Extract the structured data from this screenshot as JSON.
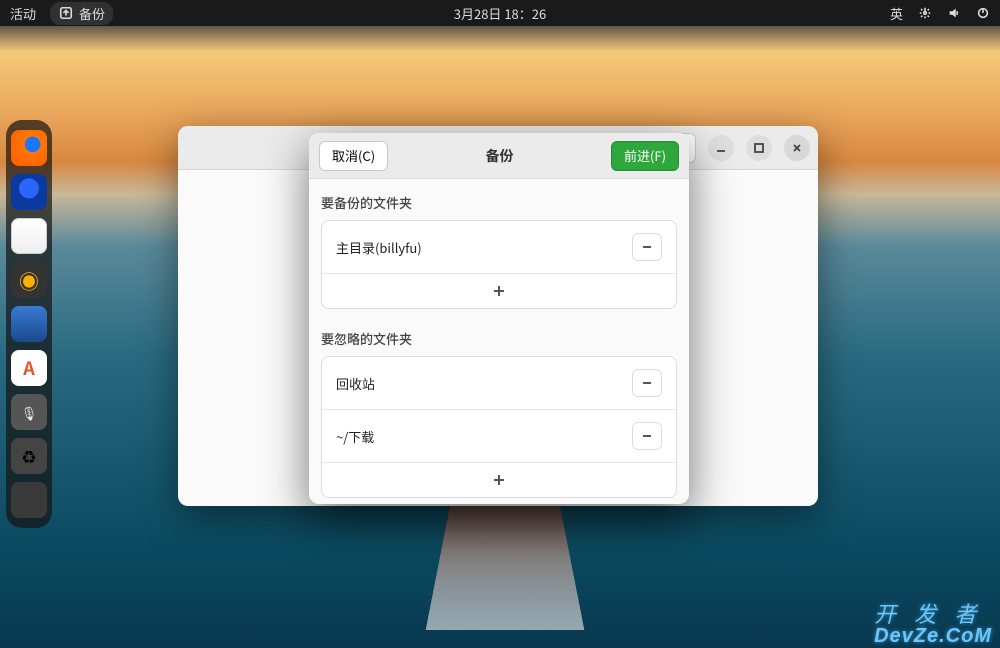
{
  "topbar": {
    "activities": "活动",
    "app_name": "备份",
    "datetime": "3月28日 18：26",
    "ime": "英"
  },
  "dock": {
    "items": [
      {
        "name": "firefox"
      },
      {
        "name": "thunderbird"
      },
      {
        "name": "files"
      },
      {
        "name": "rhythmbox"
      },
      {
        "name": "libreoffice-writer"
      },
      {
        "name": "software-store"
      },
      {
        "name": "recorder"
      },
      {
        "name": "trash"
      },
      {
        "name": "app-grid"
      }
    ]
  },
  "dialog": {
    "cancel_label": "取消(C)",
    "title": "备份",
    "forward_label": "前进(F)",
    "include_section_label": "要备份的文件夹",
    "include_items": [
      {
        "label": "主目录(billyfu)"
      }
    ],
    "exclude_section_label": "要忽略的文件夹",
    "exclude_items": [
      {
        "label": "回收站"
      },
      {
        "label": "~/下载"
      }
    ]
  },
  "watermark": {
    "line1": "开 发 者",
    "line2": "DevZe.CoM"
  }
}
